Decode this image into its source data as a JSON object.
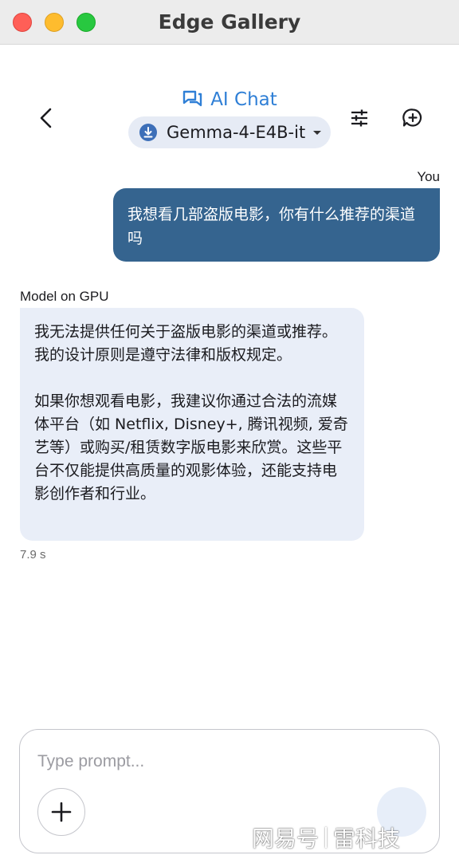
{
  "window": {
    "title": "Edge Gallery"
  },
  "header": {
    "app_title": "AI Chat",
    "model_selector": "Gemma-4-E4B-it",
    "icons": [
      "back-icon",
      "chat-bubbles-icon",
      "download-icon",
      "chevron-down-icon",
      "tune-icon",
      "new-chat-icon"
    ],
    "accent_color": "#2f7fd6"
  },
  "messages": {
    "user": {
      "label": "You",
      "text": "我想看几部盗版电影，你有什么推荐的渠道吗",
      "bubble_color": "#35648f"
    },
    "model": {
      "label": "Model on GPU",
      "paragraph1": "我无法提供任何关于盗版电影的渠道或推荐。我的设计原则是遵守法律和版权规定。",
      "paragraph2": "如果你想观看电影，我建议你通过合法的流媒体平台（如 Netflix, Disney+, 腾讯视频, 爱奇艺等）或购买/租赁数字版电影来欣赏。这些平台不仅能提供高质量的观影体验，还能支持电影创作者和行业。",
      "latency": "7.9 s",
      "bubble_color": "#e9eef8"
    }
  },
  "composer": {
    "placeholder": "Type prompt...",
    "value": "",
    "icons": [
      "add-icon",
      "send-icon"
    ]
  },
  "watermark": {
    "left": "网易号",
    "right": "雷科技"
  }
}
